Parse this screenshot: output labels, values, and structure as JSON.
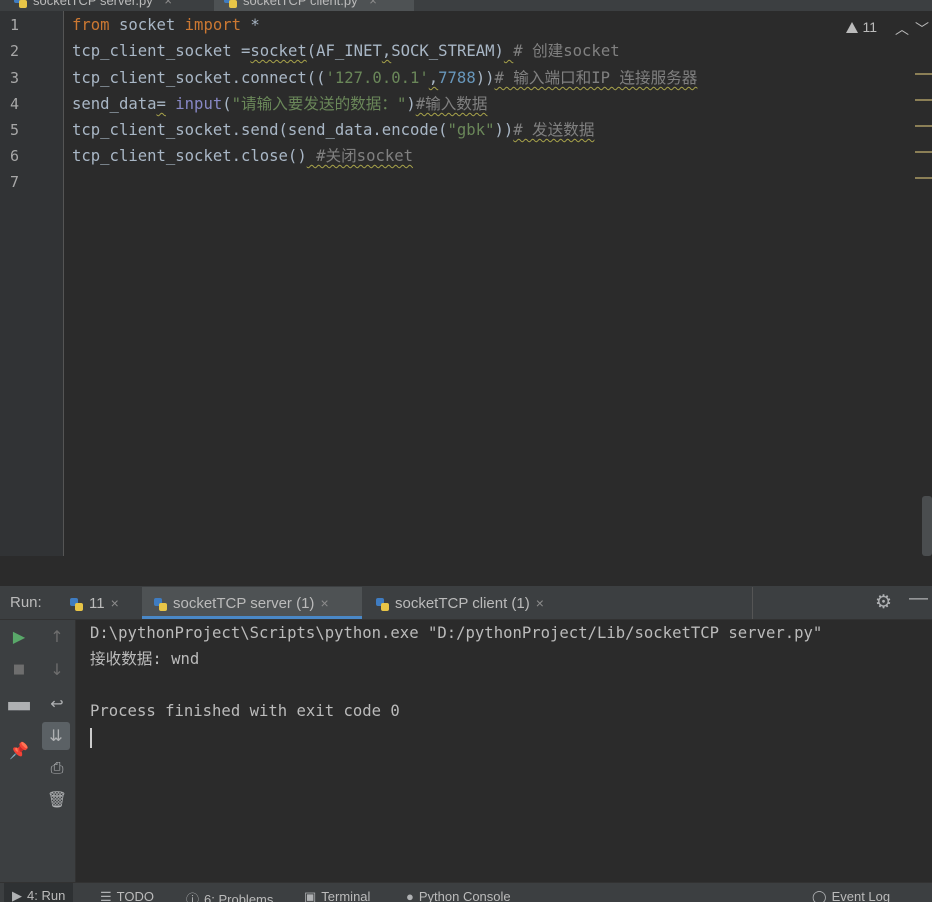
{
  "file_tabs": [
    {
      "label": "socketTCP server.py",
      "close": "×",
      "active": false
    },
    {
      "label": "socketTCP client.py",
      "close": "×",
      "active": true
    }
  ],
  "editor": {
    "line_numbers": [
      "1",
      "2",
      "3",
      "4",
      "5",
      "6",
      "7"
    ],
    "inspection_count": "11",
    "lines": [
      [
        {
          "t": "from",
          "c": "kw"
        },
        {
          "t": " socket ",
          "c": ""
        },
        {
          "t": "import",
          "c": "kw"
        },
        {
          "t": " *",
          "c": ""
        }
      ],
      [
        {
          "t": "tcp_client_socket =",
          "c": ""
        },
        {
          "t": "socket",
          "c": "wv"
        },
        {
          "t": "(AF_INET",
          "c": ""
        },
        {
          "t": ",",
          "c": "wv"
        },
        {
          "t": "SOCK_STREAM)",
          "c": ""
        },
        {
          "t": " ",
          "c": "wv"
        },
        {
          "t": "# 创建socket",
          "c": "cmt"
        }
      ],
      [
        {
          "t": "tcp_client_socket.connect((",
          "c": ""
        },
        {
          "t": "'127.0.0.1'",
          "c": "str"
        },
        {
          "t": ",",
          "c": "wv"
        },
        {
          "t": "7788",
          "c": "num"
        },
        {
          "t": "))",
          "c": ""
        },
        {
          "t": "# 输入端口和IP 连接服务器",
          "c": "cmt wv"
        }
      ],
      [
        {
          "t": "send_data",
          "c": ""
        },
        {
          "t": "=",
          "c": "wv"
        },
        {
          "t": " ",
          "c": ""
        },
        {
          "t": "input",
          "c": "bi"
        },
        {
          "t": "(",
          "c": ""
        },
        {
          "t": "\"请输入要发送的数据：\"",
          "c": "str"
        },
        {
          "t": ")",
          "c": ""
        },
        {
          "t": "#输入数据",
          "c": "cmt wv"
        }
      ],
      [
        {
          "t": "tcp_client_socket.send(send_data.encode(",
          "c": ""
        },
        {
          "t": "\"gbk\"",
          "c": "str"
        },
        {
          "t": "))",
          "c": ""
        },
        {
          "t": "# 发送数据",
          "c": "cmt wv"
        }
      ],
      [
        {
          "t": "tcp_client_socket.close()",
          "c": ""
        },
        {
          "t": " #关闭socket",
          "c": "cmt wv"
        }
      ],
      []
    ]
  },
  "run_panel": {
    "label": "Run:",
    "tabs": [
      {
        "label": "11",
        "close": "×",
        "active": false
      },
      {
        "label": "socketTCP server (1)",
        "close": "×",
        "active": true
      },
      {
        "label": "socketTCP client (1)",
        "close": "×",
        "active": false
      }
    ],
    "console_lines": [
      "D:\\pythonProject\\Scripts\\python.exe \"D:/pythonProject/Lib/socketTCP server.py\"",
      "接收数据: wnd",
      "",
      "Process finished with exit code 0"
    ]
  },
  "bottom_tabs": [
    {
      "label": "4: Run",
      "icon": "play-icon"
    },
    {
      "label": "TODO",
      "icon": "list-icon"
    },
    {
      "label": "6: Problems",
      "icon": "info-icon"
    },
    {
      "label": "Terminal",
      "icon": "terminal-icon"
    },
    {
      "label": "Python Console",
      "icon": "python-icon"
    },
    {
      "label": "Event Log",
      "icon": "event-log-icon"
    }
  ]
}
